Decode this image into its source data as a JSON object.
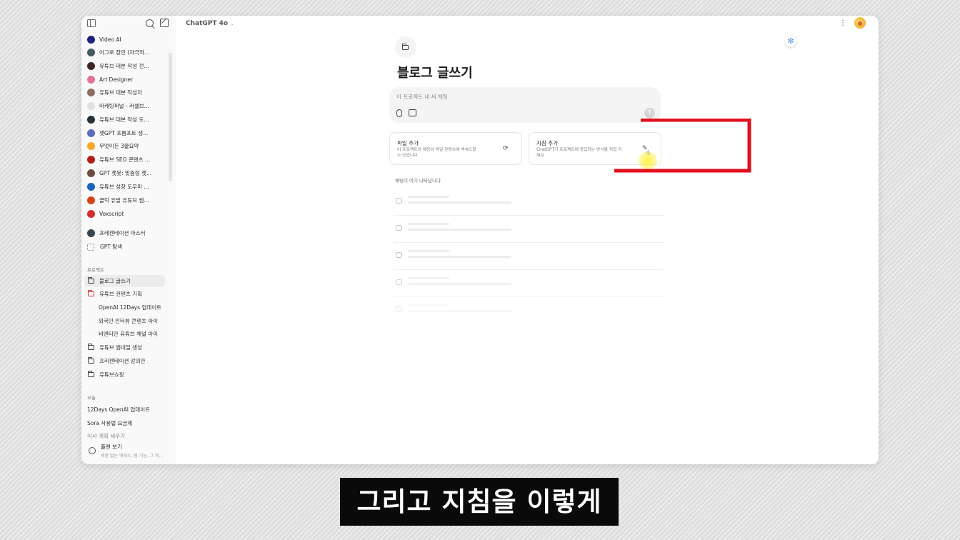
{
  "sidebar": {
    "gpts": [
      {
        "label": "Video AI",
        "color": "#1a237e"
      },
      {
        "label": "어그로 장인 (자극적...",
        "color": "#455a64"
      },
      {
        "label": "유튜브 대본 작성 전...",
        "color": "#3e2723"
      },
      {
        "label": "Art Designer",
        "color": "#e57399"
      },
      {
        "label": "유튜브 대본 작성자",
        "color": "#8d6e63"
      },
      {
        "label": "마케팅퍼널 - 러셀브...",
        "color": "#e0e0e0"
      },
      {
        "label": "유튜브 대본 작성 도...",
        "color": "#263238"
      },
      {
        "label": "챗GPT 프롬프트 생...",
        "color": "#5c6bc0"
      },
      {
        "label": "무엇이든 3줄요약",
        "color": "#f9a825"
      },
      {
        "label": "유튜브 SEO 콘텐츠 ...",
        "color": "#b71c1c"
      },
      {
        "label": "GPT 챗봇: 맞춤형 챗...",
        "color": "#6d4c41"
      },
      {
        "label": "유튜브 성장 도우미 ...",
        "color": "#1565c0"
      },
      {
        "label": "클릭 유발 유튜브 썸...",
        "color": "#d84315"
      },
      {
        "label": "Voxscript",
        "color": "#d32f2f"
      }
    ],
    "extra": [
      {
        "label": "프레젠테이션 마스터",
        "color": "#37474f"
      },
      {
        "label": "GPT 탐색",
        "color": "#9e9e9e"
      }
    ],
    "projects_title": "프로젝트",
    "projects": [
      {
        "label": "블로그 글쓰기"
      },
      {
        "label": "유튜브 컨텐츠 기획"
      }
    ],
    "subs": [
      {
        "label": "OpenAI 12Days 업데이트"
      },
      {
        "label": "외국인 인터뷰 콘텐츠 아이"
      },
      {
        "label": "비엔티안 유튜브 채널 아이"
      }
    ],
    "more_projects": [
      {
        "label": "유튜브 썸네일 생성"
      },
      {
        "label": "프리젠테이션 강의안"
      },
      {
        "label": "유튜브쇼핑"
      }
    ],
    "today_title": "오늘",
    "history": [
      {
        "label": "12Days OpenAI 업데이트"
      },
      {
        "label": "Sora 사용법 요금제"
      },
      {
        "label": "이사 계획 세우기"
      }
    ],
    "plan_title": "플랜 보기",
    "plan_sub": "제한 없는 액세스, 팀 기능, 그 외..."
  },
  "header": {
    "model": "ChatGPT 4o"
  },
  "project": {
    "title": "블로그 글쓰기",
    "composer_placeholder": "이 프로젝트 내 새 채팅"
  },
  "cards": {
    "files_title": "파일 추가",
    "files_desc_1": "이 프로젝트의 채팅이 파일 콘텐츠에 액세스할",
    "files_desc_2": "수 있습니다",
    "instr_title": "지침 추가",
    "instr_desc_1": "ChatGPT가 프로젝트에 응답하는 방식을 직접 지",
    "instr_desc_2": "세요"
  },
  "chats_label": "채팅이 여기 나타납니다",
  "caption": "그리고 지침을 이렇게",
  "colors": {
    "annotation": "#e0101e",
    "highlight": "#fff03c"
  }
}
